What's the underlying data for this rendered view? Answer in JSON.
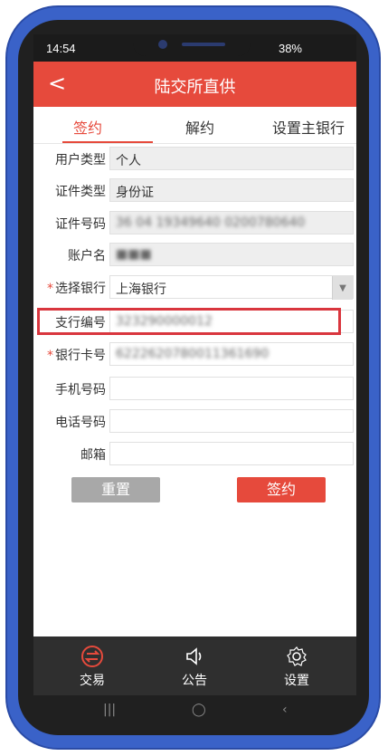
{
  "status": {
    "time": "14:54",
    "battery": "38%"
  },
  "header": {
    "back_label": "<",
    "title": "陆交所直供"
  },
  "tabs": [
    {
      "label": "签约"
    },
    {
      "label": "解约"
    },
    {
      "label": "设置主银行"
    }
  ],
  "form": {
    "user_type_label": "用户类型",
    "user_type_value": "个人",
    "id_type_label": "证件类型",
    "id_type_value": "身份证",
    "id_number_label": "证件号码",
    "id_number_value": "36 04 19349640 0200780640",
    "account_name_label": "账户名",
    "account_name_value": "■■■",
    "bank_label": "选择银行",
    "bank_value": "上海银行",
    "branch_label": "支行编号",
    "branch_value": "323290000012",
    "card_label": "银行卡号",
    "card_value": "6222620780011361690",
    "mobile_label": "手机号码",
    "phone_label": "电话号码",
    "email_label": "邮箱"
  },
  "buttons": {
    "reset": "重置",
    "sign": "签约"
  },
  "bottom_nav": [
    {
      "label": "交易",
      "icon": "trade-icon"
    },
    {
      "label": "公告",
      "icon": "speaker-icon"
    },
    {
      "label": "设置",
      "icon": "gear-icon"
    }
  ],
  "colors": {
    "accent": "#e64a3c",
    "frame": "#3a62c8"
  }
}
